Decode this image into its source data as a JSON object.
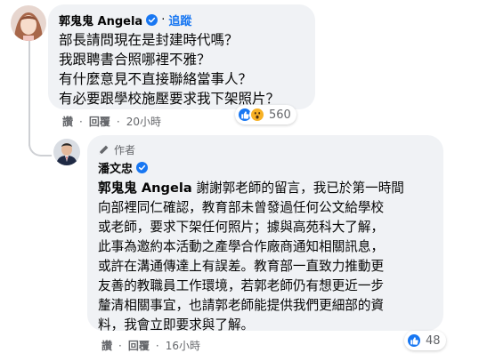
{
  "comments": [
    {
      "author": "郭鬼鬼 Angela",
      "follow_label": "追蹤",
      "separator": "·",
      "lines": [
        "部長請問現在是封建時代嗎？",
        "我跟聘書合照哪裡不雅？",
        "有什麼意見不直接聯絡當事人？",
        "有必要跟學校施壓要求我下架照片？"
      ],
      "actions": {
        "like": "讚",
        "reply": "回覆",
        "time": "20小時"
      },
      "reactions": {
        "count": "560",
        "icons": [
          "like-icon",
          "wow-icon"
        ]
      }
    },
    {
      "author_tag": "作者",
      "author": "潘文忠",
      "mention": "郭鬼鬼 Angela",
      "lines": [
        " 謝謝郭老師的留言，我已於第一時間",
        "向部裡同仁確認，教育部未曾發過任何公文給學校",
        "或老師，要求下架任何照片；據與高苑科大了解，",
        "此事為邀約本活動之產學合作廠商通知相關訊息，",
        "或許在溝通傳達上有誤差。教育部一直致力推動更",
        "友善的教職員工作環境，若郭老師仍有想更近一步",
        "釐清相關事宜，也請郭老師能提供我們更細部的資",
        "料，我會立即要求與了解。"
      ],
      "actions": {
        "like": "讚",
        "reply": "回覆",
        "time": "16小時"
      },
      "reactions": {
        "count": "48",
        "icons": [
          "like-icon"
        ]
      }
    }
  ],
  "colors": {
    "bubble": "#f0f2f5",
    "link": "#1877f2",
    "secondary_text": "#65676b",
    "thread_line": "#ced0d4"
  }
}
